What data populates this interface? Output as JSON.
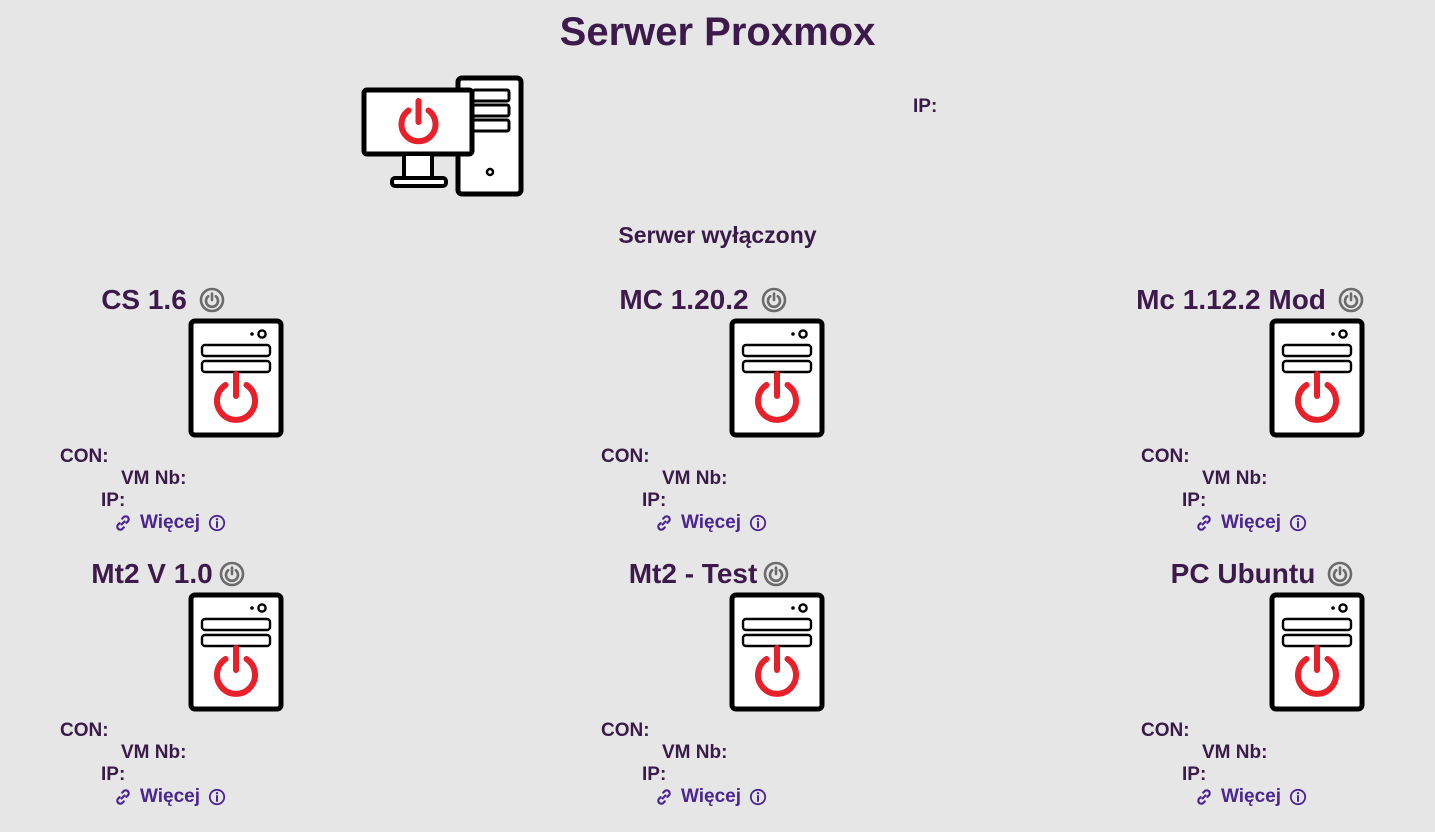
{
  "header": {
    "title": "Serwer Proxmox"
  },
  "server": {
    "ip_label": "IP:",
    "status_text": "Serwer wyłączony"
  },
  "labels": {
    "con": "CON:",
    "vm_nb": "VM Nb:",
    "ip": "IP:",
    "more": "Więcej"
  },
  "colors": {
    "background": "#e6e6e6",
    "title": "#3d1a4b",
    "link": "#4b2590",
    "power_off_red": "#e8202a",
    "power_icon_grey": "#6b6b6b"
  },
  "icons": {
    "main": "desktop-pc-power-icon",
    "vm": "server-tower-power-icon",
    "toggle": "power-toggle-icon",
    "link": "link-icon",
    "info": "info-circle-icon"
  },
  "vms": [
    {
      "name": "CS 1.6"
    },
    {
      "name": "MC 1.20.2"
    },
    {
      "name": "Mc 1.12.2 Mod"
    },
    {
      "name": "Mt2 V 1.0"
    },
    {
      "name": "Mt2 - Test"
    },
    {
      "name": "PC Ubuntu"
    }
  ]
}
